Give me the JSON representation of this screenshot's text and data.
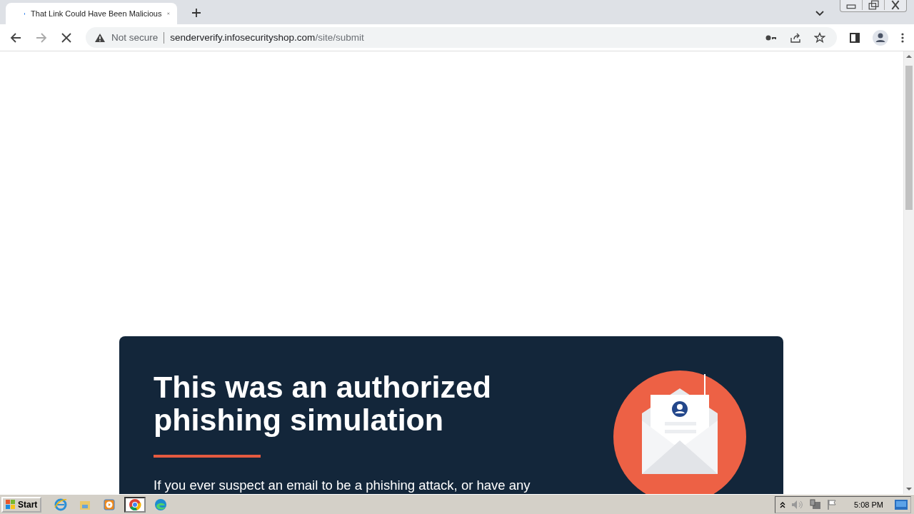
{
  "browser": {
    "tabs": [
      {
        "title": "That Link Could Have Been Malicious",
        "selected": true
      }
    ],
    "loading": true,
    "address": {
      "security": "Not secure",
      "host": "senderverify.infosecurityshop.com",
      "path": "/site/submit"
    }
  },
  "page": {
    "heading": "This was an authorized phishing simulation",
    "intro": "If you ever suspect an email to be a phishing attack, or have any"
  },
  "taskbar": {
    "start": "Start",
    "apps": [
      {
        "kind": "ie",
        "selected": false
      },
      {
        "kind": "folder",
        "selected": false
      },
      {
        "kind": "media",
        "selected": false
      },
      {
        "kind": "chrome",
        "selected": true
      },
      {
        "kind": "edge",
        "selected": false
      }
    ],
    "clock": "5:08 PM"
  }
}
